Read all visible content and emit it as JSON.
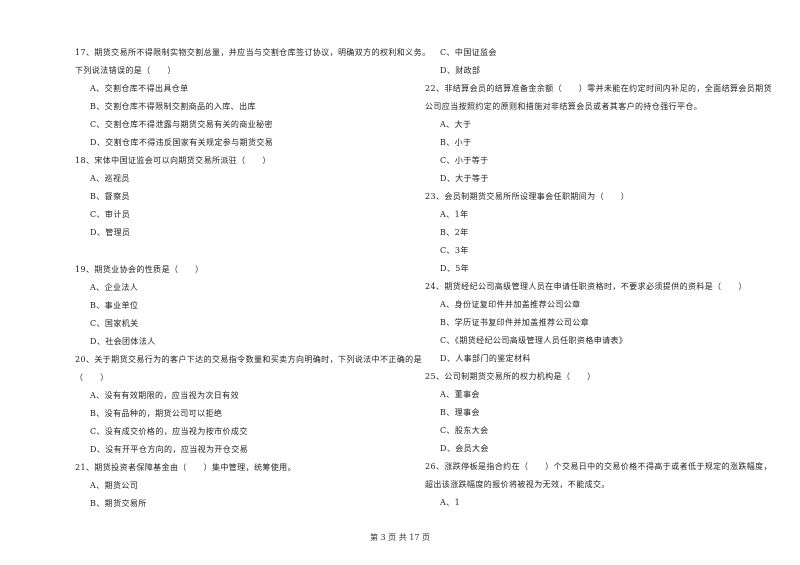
{
  "left_column": [
    {
      "kind": "question",
      "text": "17、期货交易所不得限制实物交割总量，并应当与交割仓库签订协议，明确双方的权利和义务。"
    },
    {
      "kind": "question-cont",
      "text": "下列说法错误的是（　　）"
    },
    {
      "kind": "option",
      "text": "A、交割仓库不得出具仓单"
    },
    {
      "kind": "option",
      "text": "B、交割仓库不得限制交割商品的入库、出库"
    },
    {
      "kind": "option",
      "text": "C、交割仓库不得泄露与期货交易有关的商业秘密"
    },
    {
      "kind": "option",
      "text": "D、交割仓库不得违反国家有关规定参与期货交易"
    },
    {
      "kind": "question",
      "text": "18、宋体中国证监会可以向期货交易所派驻（　　）"
    },
    {
      "kind": "option",
      "text": "A、巡视员"
    },
    {
      "kind": "option",
      "text": "B、督察员"
    },
    {
      "kind": "option",
      "text": "C、审计员"
    },
    {
      "kind": "option",
      "text": "D、管理员"
    },
    {
      "kind": "spacer",
      "text": ""
    },
    {
      "kind": "question",
      "text": "19、期货业协会的性质是（　　）"
    },
    {
      "kind": "option",
      "text": "A、企业法人"
    },
    {
      "kind": "option",
      "text": "B、事业单位"
    },
    {
      "kind": "option",
      "text": "C、国家机关"
    },
    {
      "kind": "option",
      "text": "D、社会团体法人"
    },
    {
      "kind": "question",
      "text": "20、关于期货交易行为的客户下达的交易指令数量和买卖方向明确时，下列说法中不正确的是"
    },
    {
      "kind": "question-cont",
      "text": "（　　）"
    },
    {
      "kind": "option",
      "text": "A、没有有效期限的，应当视为次日有效"
    },
    {
      "kind": "option",
      "text": "B、没有品种的，期货公司可以拒绝"
    },
    {
      "kind": "option",
      "text": "C、没有成交价格的，应当视为按市价成交"
    },
    {
      "kind": "option",
      "text": "D、没有开平仓方向的，应当视为开仓交易"
    },
    {
      "kind": "question",
      "text": "21、期货投资者保障基金由（　　）集中管理，统筹使用。"
    },
    {
      "kind": "option",
      "text": "A、期货公司"
    },
    {
      "kind": "option",
      "text": "B、期货交易所"
    }
  ],
  "right_column": [
    {
      "kind": "option",
      "text": "C、中国证监会"
    },
    {
      "kind": "option",
      "text": "D、财政部"
    },
    {
      "kind": "question",
      "text": "22、非结算会员的结算准备金余额（　　）零并未能在约定时间内补足的，全面结算会员期货"
    },
    {
      "kind": "question-cont",
      "text": "公司应当按照约定的原则和措施对非结算会员或者其客户的持仓强行平仓。"
    },
    {
      "kind": "option",
      "text": "A、大于"
    },
    {
      "kind": "option",
      "text": "B、小于"
    },
    {
      "kind": "option",
      "text": "C、小于等于"
    },
    {
      "kind": "option",
      "text": "D、大于等于"
    },
    {
      "kind": "question",
      "text": "23、会员制期货交易所所设理事会任职期间为（　　）"
    },
    {
      "kind": "option",
      "text": "A、1年"
    },
    {
      "kind": "option",
      "text": "B、2年"
    },
    {
      "kind": "option",
      "text": "C、3年"
    },
    {
      "kind": "option",
      "text": "D、5年"
    },
    {
      "kind": "question",
      "text": "24、期货经纪公司高级管理人员在申请任职资格时，不要求必须提供的资料是（　　）"
    },
    {
      "kind": "option",
      "text": "A、身份证复印件并加盖推荐公司公章"
    },
    {
      "kind": "option",
      "text": "B、学历证书复印件并加盖推荐公司公章"
    },
    {
      "kind": "option",
      "text": "C、《期货经纪公司高级管理人员任职资格申请表》"
    },
    {
      "kind": "option",
      "text": "D、人事部门的鉴定材料"
    },
    {
      "kind": "question",
      "text": "25、公司制期货交易所的权力机构是（　　）"
    },
    {
      "kind": "option",
      "text": "A、董事会"
    },
    {
      "kind": "option",
      "text": "B、理事会"
    },
    {
      "kind": "option",
      "text": "C、股东大会"
    },
    {
      "kind": "option",
      "text": "D、会员大会"
    },
    {
      "kind": "question",
      "text": "26、涨跌停板是指合约在（　　）个交易日中的交易价格不得高于或者低于规定的涨跌幅度，"
    },
    {
      "kind": "question-cont",
      "text": "超出该涨跌幅度的报价将被视为无效，不能成交。"
    },
    {
      "kind": "option",
      "text": "A、1"
    }
  ],
  "footer": {
    "page_label": "第 3 页 共 17 页"
  }
}
